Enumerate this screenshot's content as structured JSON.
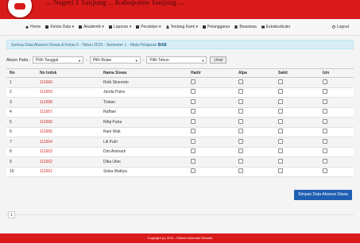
{
  "header": {
    "title": "... Negeri 1 Tanjung ... Kabupaten Tanjung ..."
  },
  "nav": {
    "items": [
      {
        "label": "Home",
        "icon": "home-icon"
      },
      {
        "label": "Kelola Data ▾",
        "icon": "grid-icon"
      },
      {
        "label": "Akademik ▾",
        "icon": "grid-icon"
      },
      {
        "label": "Laporan ▾",
        "icon": "grid-icon"
      },
      {
        "label": "Peralatan ▾",
        "icon": "grid-icon"
      },
      {
        "label": "Tentang Kami ▾",
        "icon": "user-icon"
      },
      {
        "label": "Pelanggaran",
        "icon": "grid-icon"
      },
      {
        "label": "Beasiswa",
        "icon": "book-icon"
      },
      {
        "label": "Extrakurikuler",
        "icon": "envelope-icon"
      }
    ],
    "logout": "Logout"
  },
  "alert": {
    "text": "Semua Data Absensi Siswa di Kelas 6 - Tahun 2015 - Semester 1 - Mata Pelajaran",
    "bold": "BAB"
  },
  "filter": {
    "label": "Absen Pada :",
    "tanggal": "Pilih Tanggal",
    "bulan": "Pilih Bulan",
    "tahun": "Pilih Tahun",
    "button": "Lihat"
  },
  "table": {
    "headers": [
      "No",
      "No Induk",
      "Nama Siswa",
      "Hadir",
      "Alpa",
      "Sakit",
      "Izin"
    ],
    "rows": [
      {
        "no": "1",
        "nis": "111660",
        "nama": "Robi Skorento"
      },
      {
        "no": "2",
        "nis": "111659",
        "nama": "Jenda Putra"
      },
      {
        "no": "3",
        "nis": "111658",
        "nama": "Tristan"
      },
      {
        "no": "4",
        "nis": "111657",
        "nama": "Raffael"
      },
      {
        "no": "5",
        "nis": "111656",
        "nama": "Rifqi Putra"
      },
      {
        "no": "6",
        "nis": "111655",
        "nama": "Rani Wati"
      },
      {
        "no": "7",
        "nis": "111654",
        "nama": "Lili Putri"
      },
      {
        "no": "8",
        "nis": "111653",
        "nama": "Dini Aminarti"
      },
      {
        "no": "9",
        "nis": "111652",
        "nama": "Dika Ulan"
      },
      {
        "no": "10",
        "nis": "111651",
        "nama": "Siska Wakiya"
      }
    ]
  },
  "save_button": "Simpan Data Absensi Siswa",
  "pager": "1",
  "footer": "Copyright (c) 2014 - Sistem Informasi Sekolah",
  "colors": {
    "brand_red": "#d91a1a",
    "primary_blue": "#1f5fb3",
    "link_red": "#d62b2b"
  }
}
